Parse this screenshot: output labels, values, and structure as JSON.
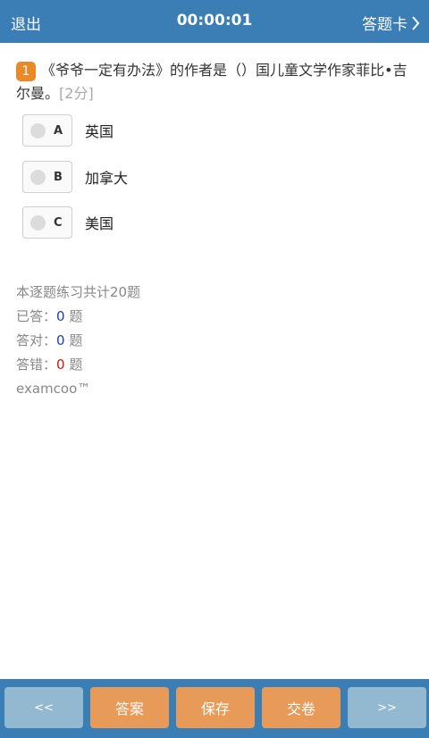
{
  "topbar": {
    "exit": "退出",
    "timer": "00:00:01",
    "answer_card": "答题卡"
  },
  "question": {
    "number": "1",
    "text": "《爷爷一定有办法》的作者是（）国儿童文学作家菲比•吉尔曼。",
    "score": "[2分]"
  },
  "options": [
    {
      "letter": "A",
      "text": "英国"
    },
    {
      "letter": "B",
      "text": "加拿大"
    },
    {
      "letter": "C",
      "text": "美国"
    }
  ],
  "stats": {
    "total": "本逐题练习共计20题",
    "answered_label": "已答：",
    "answered_count": "0",
    "correct_label": "答对：",
    "correct_count": "0",
    "wrong_label": "答错：",
    "wrong_count": "0",
    "unit": "题",
    "brand": "examcoo™"
  },
  "bottombar": {
    "prev": "<<",
    "answer": "答案",
    "save": "保存",
    "submit": "交卷",
    "next": ">>"
  },
  "colors": {
    "bar": "#3a7eb5",
    "accent": "#e89a58",
    "nav_button": "#93b9d1"
  }
}
